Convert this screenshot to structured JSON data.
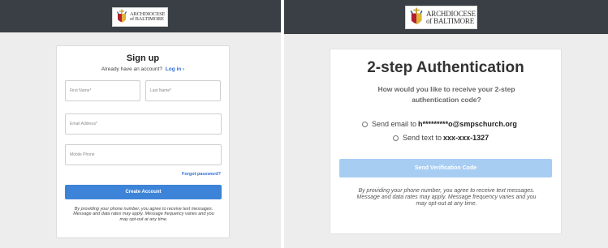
{
  "brand": {
    "line1": "ARCHDIOCESE",
    "line2": "of BALTIMORE",
    "logo_icon": "archdiocese-crest",
    "header_color": "#3a3f45"
  },
  "signup": {
    "title": "Sign up",
    "have_account_text": "Already have an account?",
    "login_link": "Log in ›",
    "first_name_placeholder": "First Name*",
    "last_name_placeholder": "Last Name*",
    "email_placeholder": "Email Address*",
    "phone_placeholder": "Mobile Phone",
    "forgot_password": "Forgot password?",
    "create_button": "Create Account",
    "disclaimer": "By providing your phone number, you agree to receive text messages. Message and data rates may apply. Message frequency varies and you may opt-out at any time.",
    "accent_color": "#3d84d8"
  },
  "two_step": {
    "title": "2-step Authentication",
    "question": "How would you like to receive your 2-step authentication code?",
    "options": [
      {
        "prefix": "Send email to",
        "value": "h*********o@smpschurch.org",
        "selected": false
      },
      {
        "prefix": "Send text to",
        "value": "xxx-xxx-1327",
        "selected": false
      }
    ],
    "send_button": "Send Verification Code",
    "disclaimer": "By providing your phone number, you agree to receive text messages. Message and data rates may apply. Message frequency varies and you may opt-out at any time.",
    "button_color": "#a8cdf2"
  }
}
